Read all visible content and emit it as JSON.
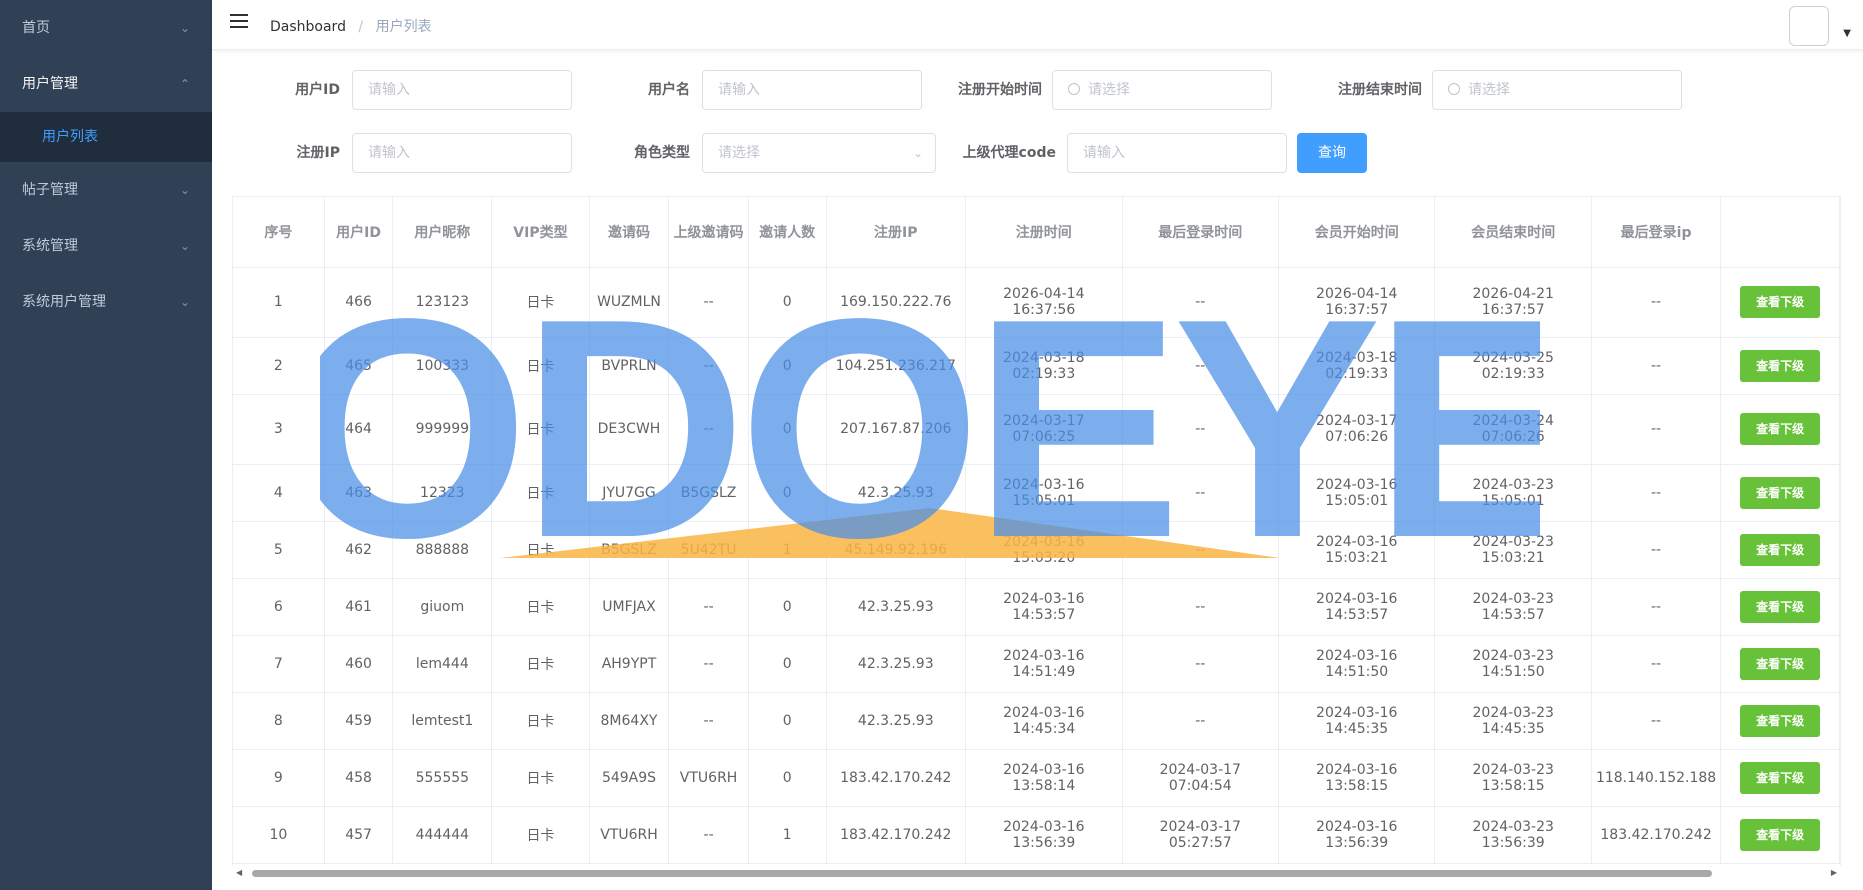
{
  "sidebar": {
    "items": [
      {
        "label": "首页",
        "arrow": "⌄"
      },
      {
        "label": "用户管理",
        "arrow": "⌃"
      },
      {
        "label": "帖子管理",
        "arrow": "⌄"
      },
      {
        "label": "系统管理",
        "arrow": "⌄"
      },
      {
        "label": "系统用户管理",
        "arrow": "⌄"
      }
    ],
    "sub_items": [
      {
        "label": "用户列表"
      }
    ]
  },
  "header": {
    "breadcrumb_home": "Dashboard",
    "breadcrumb_sep": "/",
    "breadcrumb_current": "用户列表"
  },
  "filters": {
    "user_id": {
      "label": "用户ID",
      "placeholder": "请输入"
    },
    "username": {
      "label": "用户名",
      "placeholder": "请输入"
    },
    "reg_start": {
      "label": "注册开始时间",
      "placeholder": "请选择"
    },
    "reg_end": {
      "label": "注册结束时间",
      "placeholder": "请选择"
    },
    "reg_ip": {
      "label": "注册IP",
      "placeholder": "请输入"
    },
    "role_type": {
      "label": "角色类型",
      "placeholder": "请选择"
    },
    "parent_code": {
      "label": "上级代理code",
      "placeholder": "请输入"
    },
    "query_label": "查询"
  },
  "table": {
    "headers": [
      "序号",
      "用户ID",
      "用户昵称",
      "VIP类型",
      "邀请码",
      "上级邀请码",
      "邀请人数",
      "注册IP",
      "注册时间",
      "最后登录时间",
      "会员开始时间",
      "会员结束时间",
      "最后登录ip",
      ""
    ],
    "action_label": "查看下级",
    "rows": [
      [
        "1",
        "466",
        "123123",
        "日卡",
        "WUZMLN",
        "--",
        "0",
        "169.150.222.76",
        "2026-04-14 16:37:56",
        "--",
        "2026-04-14 16:37:57",
        "2026-04-21 16:37:57",
        "--"
      ],
      [
        "2",
        "465",
        "100333",
        "日卡",
        "BVPRLN",
        "--",
        "0",
        "104.251.236.217",
        "2024-03-18 02:19:33",
        "--",
        "2024-03-18 02:19:33",
        "2024-03-25 02:19:33",
        "--"
      ],
      [
        "3",
        "464",
        "999999",
        "日卡",
        "DE3CWH",
        "--",
        "0",
        "207.167.87.206",
        "2024-03-17 07:06:25",
        "--",
        "2024-03-17 07:06:26",
        "2024-03-24 07:06:26",
        "--"
      ],
      [
        "4",
        "463",
        "12323",
        "日卡",
        "JYU7GG",
        "B5GSLZ",
        "0",
        "42.3.25.93",
        "2024-03-16 15:05:01",
        "--",
        "2024-03-16 15:05:01",
        "2024-03-23 15:05:01",
        "--"
      ],
      [
        "5",
        "462",
        "888888",
        "日卡",
        "B5GSLZ",
        "5U42TU",
        "1",
        "45.149.92.196",
        "2024-03-16 15:03:20",
        "--",
        "2024-03-16 15:03:21",
        "2024-03-23 15:03:21",
        "--"
      ],
      [
        "6",
        "461",
        "giuom",
        "日卡",
        "UMFJAX",
        "--",
        "0",
        "42.3.25.93",
        "2024-03-16 14:53:57",
        "--",
        "2024-03-16 14:53:57",
        "2024-03-23 14:53:57",
        "--"
      ],
      [
        "7",
        "460",
        "lem444",
        "日卡",
        "AH9YPT",
        "--",
        "0",
        "42.3.25.93",
        "2024-03-16 14:51:49",
        "--",
        "2024-03-16 14:51:50",
        "2024-03-23 14:51:50",
        "--"
      ],
      [
        "8",
        "459",
        "lemtest1",
        "日卡",
        "8M64XY",
        "--",
        "0",
        "42.3.25.93",
        "2024-03-16 14:45:34",
        "--",
        "2024-03-16 14:45:35",
        "2024-03-23 14:45:35",
        "--"
      ],
      [
        "9",
        "458",
        "555555",
        "日卡",
        "549A9S",
        "VTU6RH",
        "0",
        "183.42.170.242",
        "2024-03-16 13:58:14",
        "2024-03-17 07:04:54",
        "2024-03-16 13:58:15",
        "2024-03-23 13:58:15",
        "118.140.152.188"
      ],
      [
        "10",
        "457",
        "444444",
        "日卡",
        "VTU6RH",
        "--",
        "1",
        "183.42.170.242",
        "2024-03-16 13:56:39",
        "2024-03-17 05:27:57",
        "2024-03-16 13:56:39",
        "2024-03-23 13:56:39",
        "183.42.170.242"
      ]
    ]
  },
  "watermark": {
    "text": "ODOEYE",
    "color": "#4a8fe8",
    "accent": "#f9b544"
  },
  "colors": {
    "sidebar_bg": "#304156",
    "primary": "#409eff",
    "success": "#67c23a"
  }
}
